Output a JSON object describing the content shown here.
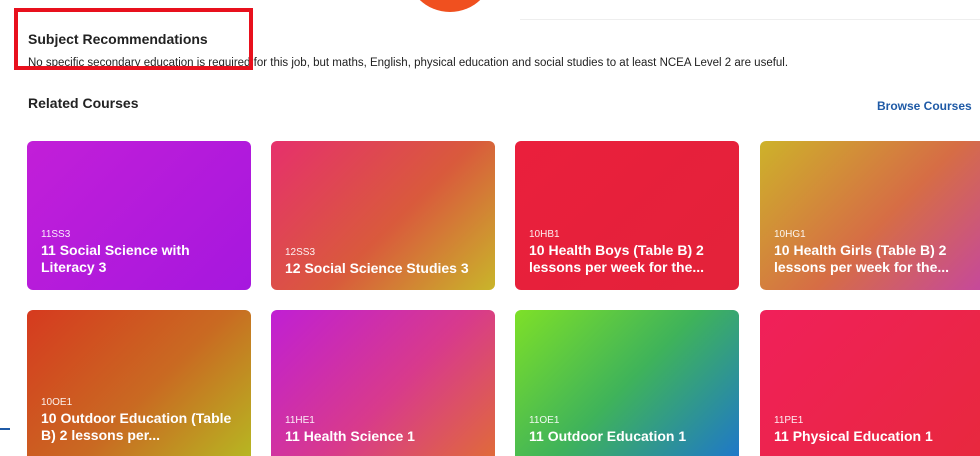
{
  "subject": {
    "title": "Subject Recommendations",
    "description": "No specific secondary education is required for this job, but maths, English, physical education and social studies to at least NCEA Level 2 are useful."
  },
  "related": {
    "title": "Related Courses",
    "browse_label": "Browse Courses"
  },
  "colors": {
    "highlight": "#e8101d",
    "accent_circle": "#f0501f",
    "link": "#1f5aa6"
  },
  "courses": [
    {
      "code": "11SS3",
      "name": "11 Social Science with Literacy 3"
    },
    {
      "code": "12SS3",
      "name": "12 Social Science Studies 3"
    },
    {
      "code": "10HB1",
      "name": "10 Health Boys (Table B) 2 lessons per week for the..."
    },
    {
      "code": "10HG1",
      "name": "10 Health Girls (Table B) 2 lessons per week for the..."
    },
    {
      "code": "10OE1",
      "name": "10 Outdoor Education (Table B) 2 lessons per..."
    },
    {
      "code": "11HE1",
      "name": "11 Health Science 1"
    },
    {
      "code": "11OE1",
      "name": "11 Outdoor Education 1"
    },
    {
      "code": "11PE1",
      "name": "11 Physical Education 1"
    }
  ]
}
